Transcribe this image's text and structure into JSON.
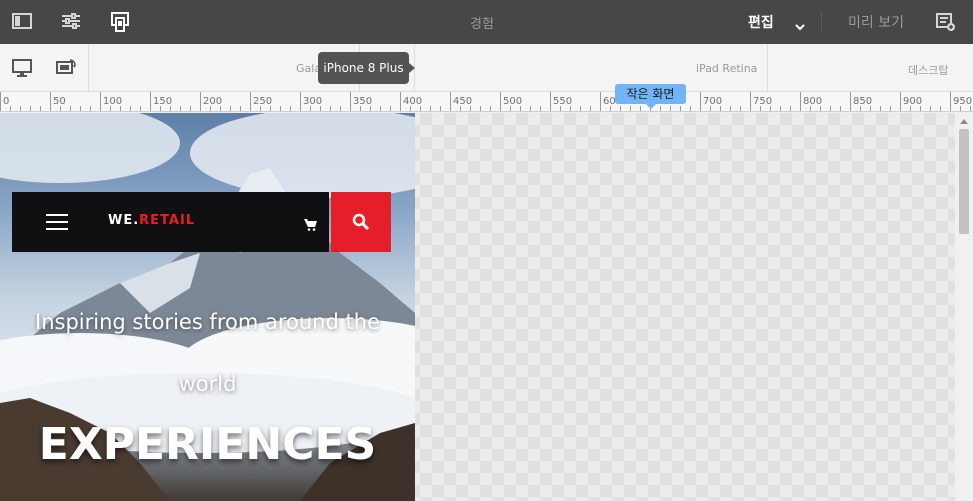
{
  "topbar": {
    "icons": [
      "sidebar-toggle-icon",
      "properties-sliders-icon",
      "emulator-devices-icon"
    ],
    "title": "경험",
    "mode_label": "편집",
    "preview_label": "미리 보기",
    "annotations_icon": "annotations-icon"
  },
  "emulator": {
    "device_icons": [
      "desktop-icon",
      "rotate-device-icon"
    ],
    "breakpoints": [
      {
        "label": "Gala"
      },
      {
        "label": "iPad Retina"
      },
      {
        "label": "데스크탑"
      }
    ],
    "active_device_tooltip": "iPhone 8 Plus"
  },
  "ruler": {
    "ticks": [
      "0",
      "50",
      "100",
      "150",
      "200",
      "250",
      "300",
      "350",
      "400",
      "450",
      "500",
      "550",
      "600",
      "650",
      "700",
      "750",
      "800",
      "850",
      "900",
      "950"
    ],
    "breakpoint_tooltip": "작은 화면"
  },
  "page": {
    "brand_prefix": "WE.",
    "brand_suffix": "RETAIL",
    "hero_line1": "Inspiring stories from around the",
    "hero_line2": "world",
    "hero_title": "EXPERIENCES"
  },
  "colors": {
    "topbar": "#474747",
    "brand_red": "#e62027",
    "tooltip_blue": "#72b4f5"
  }
}
